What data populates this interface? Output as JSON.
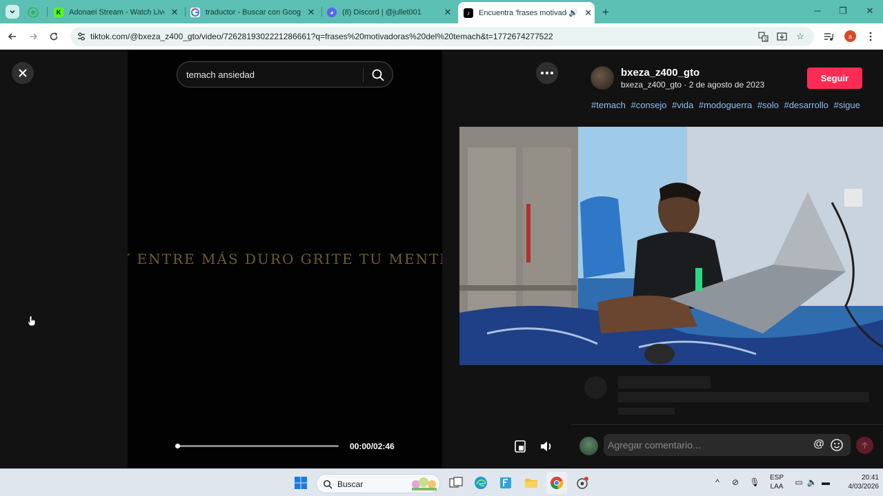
{
  "browser": {
    "tabs": [
      {
        "title": "",
        "favicon": "whatsapp-icon",
        "color": "#25d366"
      },
      {
        "title": "Adonaei Stream - Watch Live o",
        "favicon": "kick-icon",
        "color": "#53fc18"
      },
      {
        "title": "traductor - Buscar con Google",
        "favicon": "google-icon",
        "color": "#4285f4"
      },
      {
        "title": "(8) Discord | @jullet001",
        "favicon": "discord-icon",
        "color": "#5865f2"
      },
      {
        "title": "Encuentra 'frases motivado",
        "favicon": "tiktok-icon",
        "color": "#000000",
        "active": true
      }
    ],
    "url": "tiktok.com/@bxeza_z400_gto/video/7262819302221286661?q=frases%20motivadoras%20del%20temach&t=1772674277522",
    "profile_initial": "a"
  },
  "player": {
    "search_value": "temach ansiedad",
    "caption": "Y ENTRE MÁS DURO GRITE TU MENTE",
    "time": "00:00/02:46",
    "progress": 0.0
  },
  "video_info": {
    "author_name": "bxeza_z400_gto",
    "author_sub": "bxeza_z400_gto · 2 de agosto de 2023",
    "follow_label": "Seguir",
    "hashtags": [
      "#temach",
      "#consejo",
      "#vida",
      "#modoguerra",
      "#solo",
      "#desarrollo",
      "#sigue"
    ]
  },
  "comments": {
    "placeholder": "Agregar comentario..."
  },
  "taskbar": {
    "search_label": "Buscar",
    "lang_top": "ESP",
    "lang_bottom": "LAA",
    "time": "20:41",
    "date": "4/03/2026"
  },
  "colors": {
    "tabstrip": "#5bbfb3",
    "follow": "#fe2c55",
    "hashtag": "#8fbff0",
    "caption": "#6d5d2e"
  }
}
